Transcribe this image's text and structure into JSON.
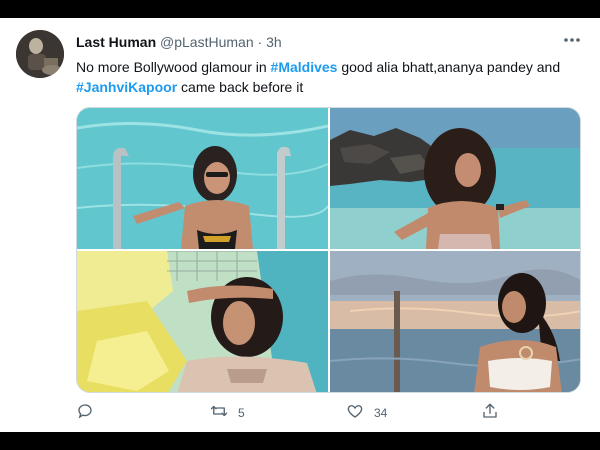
{
  "tweet": {
    "display_name": "Last Human",
    "handle": "@pLastHuman",
    "separator": " · ",
    "time": "3h",
    "more_icon": "more-horizontal-icon",
    "text_parts": {
      "t1": "No more Bollywood glamour in ",
      "tag1": "#Maldives",
      "t2": " good alia bhatt,ananya pandey and ",
      "tag2": "#JanhviKapoor",
      "t3": " came back before it"
    },
    "photos_count": 4,
    "actions": {
      "reply_count": "",
      "retweet_count": "5",
      "like_count": "34",
      "share_count": ""
    }
  },
  "colors": {
    "link": "#1d9bf0",
    "text": "#0f1419",
    "secondary": "#536471",
    "border": "#cfd9de"
  }
}
